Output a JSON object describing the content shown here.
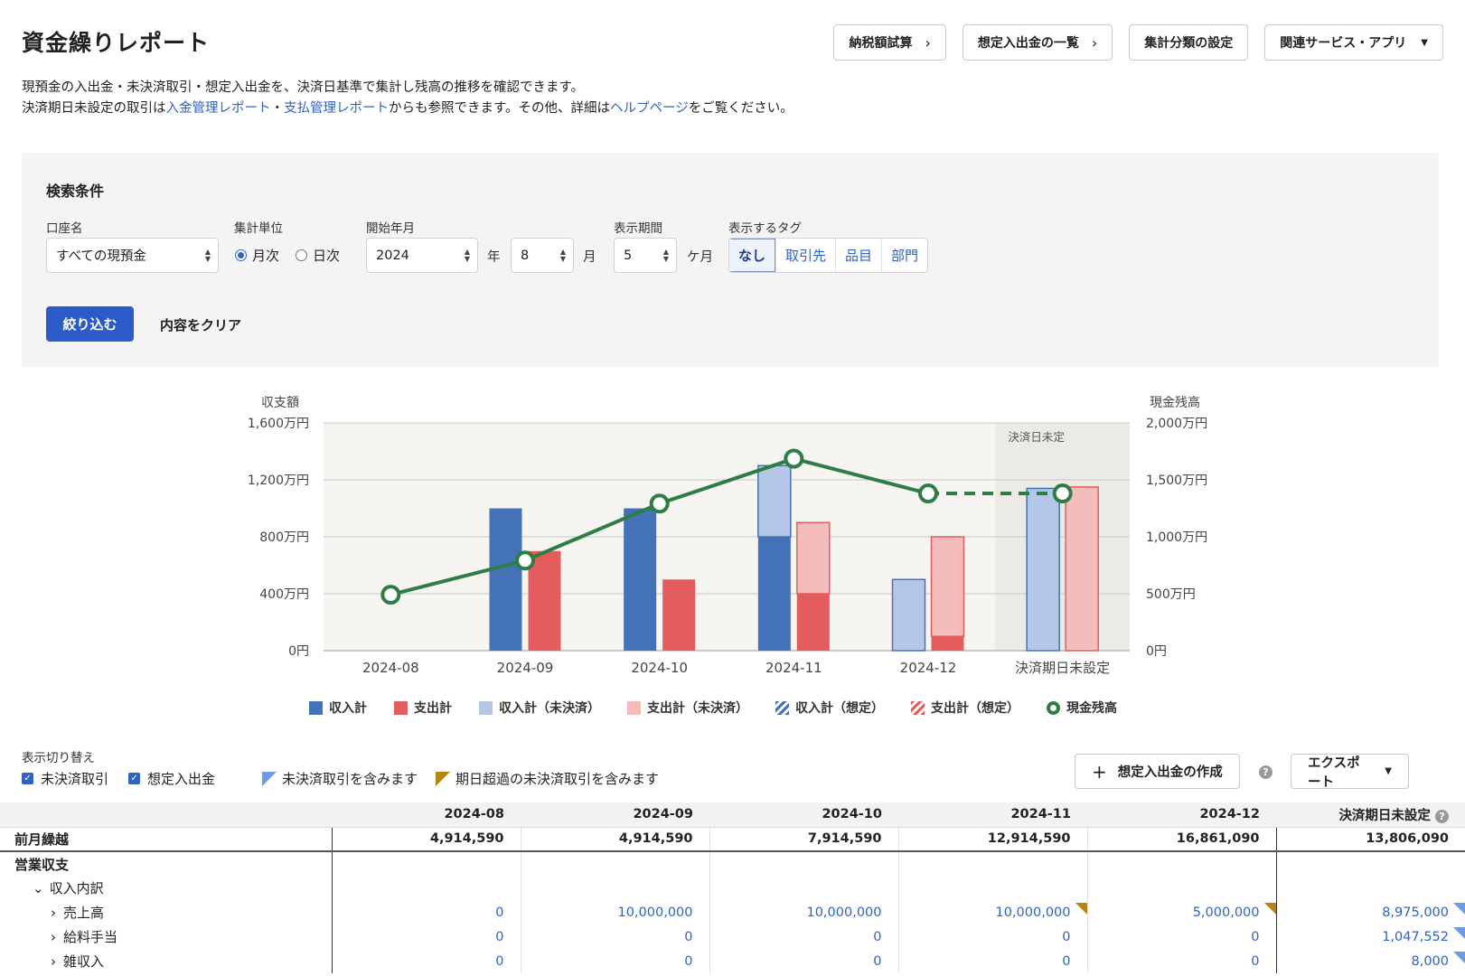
{
  "header": {
    "title": "資金繰りレポート",
    "buttons": {
      "tax_calc": "納税額試算",
      "expected_list": "想定入出金の一覧",
      "category_settings": "集計分類の設定",
      "related_services": "関連サービス・アプリ"
    }
  },
  "description": {
    "line1": "現預金の入出金・未決済取引・想定入出金を、決済日基準で集計し残高の推移を確認できます。",
    "line2_pre": "決済期日未設定の取引は",
    "link_income": "入金管理レポート",
    "line2_sep": "・",
    "link_payment": "支払管理レポート",
    "line2_mid": "からも参照できます。その他、詳細は",
    "link_help": "ヘルプページ",
    "line2_post": "をご覧ください。"
  },
  "search": {
    "title": "検索条件",
    "account_label": "口座名",
    "account_value": "すべての現預金",
    "unit_label": "集計単位",
    "unit_monthly": "月次",
    "unit_daily": "日次",
    "start_label": "開始年月",
    "start_year": "2024",
    "year_suffix": "年",
    "start_month": "8",
    "month_suffix": "月",
    "period_label": "表示期間",
    "period_value": "5",
    "period_suffix": "ケ月",
    "tag_label": "表示するタグ",
    "tags": [
      "なし",
      "取引先",
      "品目",
      "部門"
    ],
    "filter_button": "絞り込む",
    "clear_button": "内容をクリア"
  },
  "chart_data": {
    "type": "bar",
    "left_axis_title": "収支額",
    "right_axis_title": "現金残高",
    "left_ticks": [
      "1,600万円",
      "1,200万円",
      "800万円",
      "400万円",
      "0円"
    ],
    "right_ticks": [
      "2,000万円",
      "1,500万円",
      "1,000万円",
      "500万円",
      "0円"
    ],
    "ylim_left": [
      0,
      16000000
    ],
    "ylim_right": [
      0,
      20000000
    ],
    "categories": [
      "2024-08",
      "2024-09",
      "2024-10",
      "2024-11",
      "2024-12",
      "決済期日未設定"
    ],
    "unsettled_band_label": "決済日未定",
    "series": [
      {
        "name": "収入計",
        "values": [
          0,
          10000000,
          10000000,
          8000000,
          0,
          0
        ],
        "color": "#4472b8"
      },
      {
        "name": "収入計（未決済）",
        "values": [
          0,
          0,
          0,
          5000000,
          5000000,
          11400000
        ],
        "color": "#b4c7e7"
      },
      {
        "name": "支出計",
        "values": [
          0,
          7000000,
          5000000,
          4000000,
          1000000,
          0
        ],
        "color": "#e55c5c"
      },
      {
        "name": "支出計（未決済）",
        "values": [
          0,
          0,
          0,
          5000000,
          7000000,
          11500000
        ],
        "color": "#f4bcbc"
      },
      {
        "name": "現金残高",
        "values": [
          4914590,
          7914590,
          12914590,
          16861090,
          13806090,
          13806090
        ],
        "color": "#2e7d45"
      }
    ],
    "legend": [
      "収入計",
      "支出計",
      "収入計（未決済）",
      "支出計（未決済）",
      "収入計（想定）",
      "支出計（想定）",
      "現金残高"
    ],
    "legend_position": "bottom"
  },
  "toggles": {
    "label": "表示切り替え",
    "unsettled": "未決済取引",
    "expected": "想定入出金",
    "note_blue": "未決済取引を含みます",
    "note_gold": "期日超過の未決済取引を含みます"
  },
  "actions": {
    "create_expected": "想定入出金の作成",
    "export": "エクスポート",
    "help": "?"
  },
  "table": {
    "columns": [
      "2024-08",
      "2024-09",
      "2024-10",
      "2024-11",
      "2024-12",
      "決済期日未設定"
    ],
    "carry_label": "前月繰越",
    "carry": [
      "4,914,590",
      "4,914,590",
      "7,914,590",
      "12,914,590",
      "16,861,090",
      "13,806,090"
    ],
    "section": "営業収支",
    "group": "収入内訳",
    "rows": [
      {
        "label": "売上高",
        "values": [
          "0",
          "10,000,000",
          "10,000,000",
          "10,000,000",
          "5,000,000",
          "8,975,000"
        ]
      },
      {
        "label": "給料手当",
        "values": [
          "0",
          "0",
          "0",
          "0",
          "0",
          "1,047,552"
        ]
      },
      {
        "label": "雑収入",
        "values": [
          "0",
          "0",
          "0",
          "0",
          "0",
          "8,000"
        ]
      }
    ]
  }
}
